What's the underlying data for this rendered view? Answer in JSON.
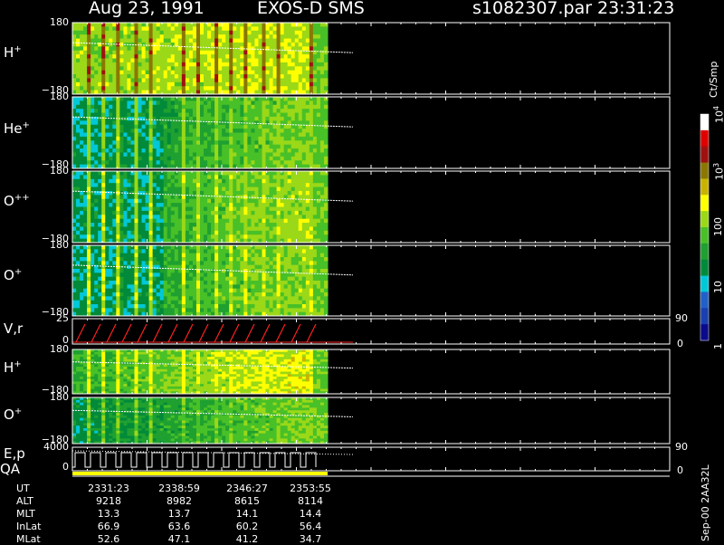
{
  "header": {
    "date": "Aug 23, 1991",
    "instrument": "EXOS-D SMS",
    "file": "s1082307.par",
    "time": "23:31:23"
  },
  "colors": {
    "axis": "#ffffff",
    "background": "#000000",
    "velocity_trace": "#ff2020",
    "scale": [
      "#0a0a8c",
      "#1a3fb0",
      "#2060c8",
      "#00c8d8",
      "#008a3a",
      "#1fa030",
      "#48c028",
      "#9ad818",
      "#ffff00",
      "#c8b400",
      "#8a7800",
      "#a01010",
      "#e00000",
      "#ffffff"
    ]
  },
  "panels": [
    {
      "id": "h-plus",
      "label": "H",
      "sup": "+",
      "top_tick": "180",
      "bottom_tick": "−180"
    },
    {
      "id": "he-plus",
      "label": "He",
      "sup": "+",
      "top_tick": "180",
      "bottom_tick": "−180"
    },
    {
      "id": "o-plus-plus",
      "label": "O",
      "sup": "++",
      "top_tick": "180",
      "bottom_tick": "−180"
    },
    {
      "id": "o-plus",
      "label": "O",
      "sup": "+",
      "top_tick": "180",
      "bottom_tick": "−180"
    },
    {
      "id": "vr",
      "label": "V,r",
      "sup": "",
      "top_tick": "25",
      "bottom_tick": "0",
      "right_top": "90",
      "right_bottom": "0"
    },
    {
      "id": "h-plus-2",
      "label": "H",
      "sup": "+",
      "top_tick": "180",
      "bottom_tick": "−180"
    },
    {
      "id": "o-plus-2",
      "label": "O",
      "sup": "+",
      "top_tick": "180",
      "bottom_tick": "−180"
    },
    {
      "id": "ep",
      "label": "E,p",
      "sup": "",
      "top_tick": "4000",
      "bottom_tick": "0",
      "right_top": "90",
      "right_bottom": "0"
    }
  ],
  "qa_label": "QA",
  "colorbar": {
    "unit": "Ct/Smp",
    "labels": [
      {
        "text": "10",
        "sup": "4",
        "value": 10000
      },
      {
        "text": "10",
        "sup": "3",
        "value": 1000
      },
      {
        "text": "100",
        "sup": "",
        "value": 100
      },
      {
        "text": "10",
        "sup": "",
        "value": 10
      },
      {
        "text": "1",
        "sup": "",
        "value": 1
      }
    ]
  },
  "footer_id": "Sep-00 2AA32L",
  "ephemeris": {
    "rows": [
      {
        "name": "UT",
        "values": [
          "2331:23",
          "2338:59",
          "2346:27",
          "2353:55"
        ]
      },
      {
        "name": "ALT",
        "values": [
          "9218",
          "8982",
          "8615",
          "8114"
        ]
      },
      {
        "name": "MLT",
        "values": [
          "13.3",
          "13.7",
          "14.1",
          "14.4"
        ]
      },
      {
        "name": "InLat",
        "values": [
          "66.9",
          "63.6",
          "60.2",
          "56.4"
        ]
      },
      {
        "name": "MLat",
        "values": [
          "52.6",
          "47.1",
          "41.2",
          "34.7"
        ]
      }
    ]
  },
  "chart_data": {
    "type": "heatmap",
    "title": "Aug 23, 1991 EXOS-D SMS",
    "x_label": "UT",
    "x_ticks": [
      "2331:23",
      "2338:59",
      "2346:27",
      "2353:55"
    ],
    "y_range_angle": [
      -180,
      180
    ],
    "z_scale": "log",
    "z_range": [
      1,
      10000
    ],
    "z_unit": "Ct/Smp",
    "data_fraction_of_time_axis": 0.42,
    "spin_period_count": 16,
    "series": [
      {
        "name": "H+",
        "base_level": 200,
        "pulse_level": 2500
      },
      {
        "name": "He+",
        "base_level": 20,
        "pulse_level": 200
      },
      {
        "name": "O++",
        "base_level": 30,
        "pulse_level": 250
      },
      {
        "name": "O+",
        "base_level": 25,
        "pulse_level": 300
      },
      {
        "name": "H+ (2)",
        "base_level": 60,
        "pulse_level": 400
      },
      {
        "name": "O+ (2)",
        "base_level": 20,
        "pulse_level": 150
      }
    ],
    "vr_range": [
      0,
      25
    ],
    "ep_range": [
      0,
      4000
    ]
  }
}
